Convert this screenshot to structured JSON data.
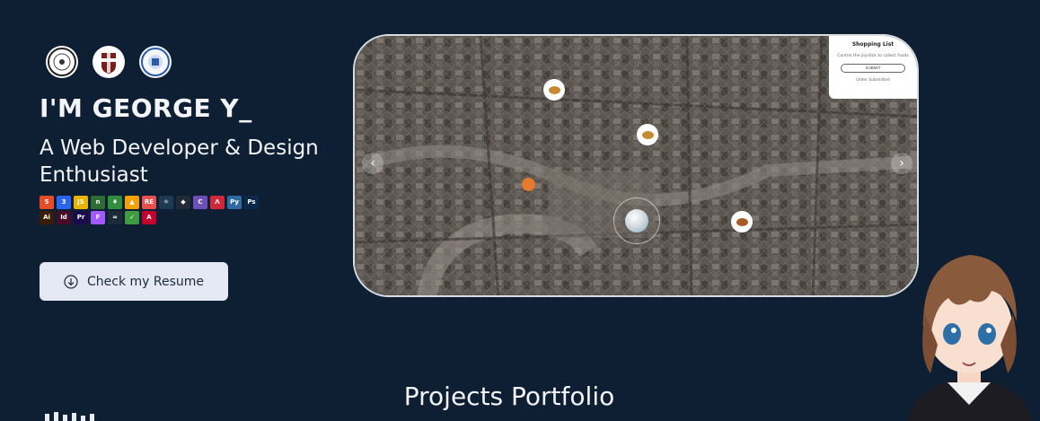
{
  "hero": {
    "headline": "I'M GEORGE Y_",
    "subheadline": "A Web Developer & Design Enthusiast",
    "resume_button": "Check my Resume"
  },
  "school_logos": [
    "risd-seal-icon",
    "brown-crest-icon",
    "school-seal-icon"
  ],
  "skills": [
    {
      "name": "html5-icon",
      "glyph": "5",
      "color": "#e44d26"
    },
    {
      "name": "css3-icon",
      "glyph": "3",
      "color": "#2965f1"
    },
    {
      "name": "javascript-icon",
      "glyph": "JS",
      "color": "#e9b400"
    },
    {
      "name": "nodejs-icon",
      "glyph": "n",
      "color": "#2f6b34"
    },
    {
      "name": "mongodb-icon",
      "glyph": "♦",
      "color": "#2f8f3e"
    },
    {
      "name": "firebase-icon",
      "glyph": "▲",
      "color": "#f5a100"
    },
    {
      "name": "rescript-icon",
      "glyph": "RE",
      "color": "#e84f4f"
    },
    {
      "name": "react-icon",
      "glyph": "⚛",
      "color": "#1d3a52"
    },
    {
      "name": "unity-icon",
      "glyph": "◆",
      "color": "#222a36"
    },
    {
      "name": "c-icon",
      "glyph": "C",
      "color": "#6d4fb8"
    },
    {
      "name": "nestjs-icon",
      "glyph": "Λ",
      "color": "#d0283a"
    },
    {
      "name": "python-icon",
      "glyph": "Py",
      "color": "#2f6aa3"
    },
    {
      "name": "photoshop-icon",
      "glyph": "Ps",
      "color": "#0b2a4a"
    },
    {
      "name": "illustrator-icon",
      "glyph": "Ai",
      "color": "#3b1c06"
    },
    {
      "name": "indesign-icon",
      "glyph": "Id",
      "color": "#4a0b28"
    },
    {
      "name": "premiere-icon",
      "glyph": "Pr",
      "color": "#1a0b4a"
    },
    {
      "name": "figma-icon",
      "glyph": "F",
      "color": "#a259ff"
    },
    {
      "name": "spline-icon",
      "glyph": "≈",
      "color": "#1d2a3a"
    },
    {
      "name": "vim-icon",
      "glyph": "✓",
      "color": "#3f9b3f"
    },
    {
      "name": "angular-icon",
      "glyph": "A",
      "color": "#c3002f"
    }
  ],
  "game": {
    "shopping_title": "Shopping List",
    "shopping_desc": "Control the joystick to collect foods",
    "submit_label": "SUBMIT",
    "order_status": "Order Submitted",
    "nav_prev": "‹",
    "nav_next": "›"
  },
  "projects": {
    "title": "Projects Portfolio"
  },
  "colors": {
    "background": "#0e1f33",
    "button": "#e4e9f3",
    "text": "#f2f4f7"
  }
}
